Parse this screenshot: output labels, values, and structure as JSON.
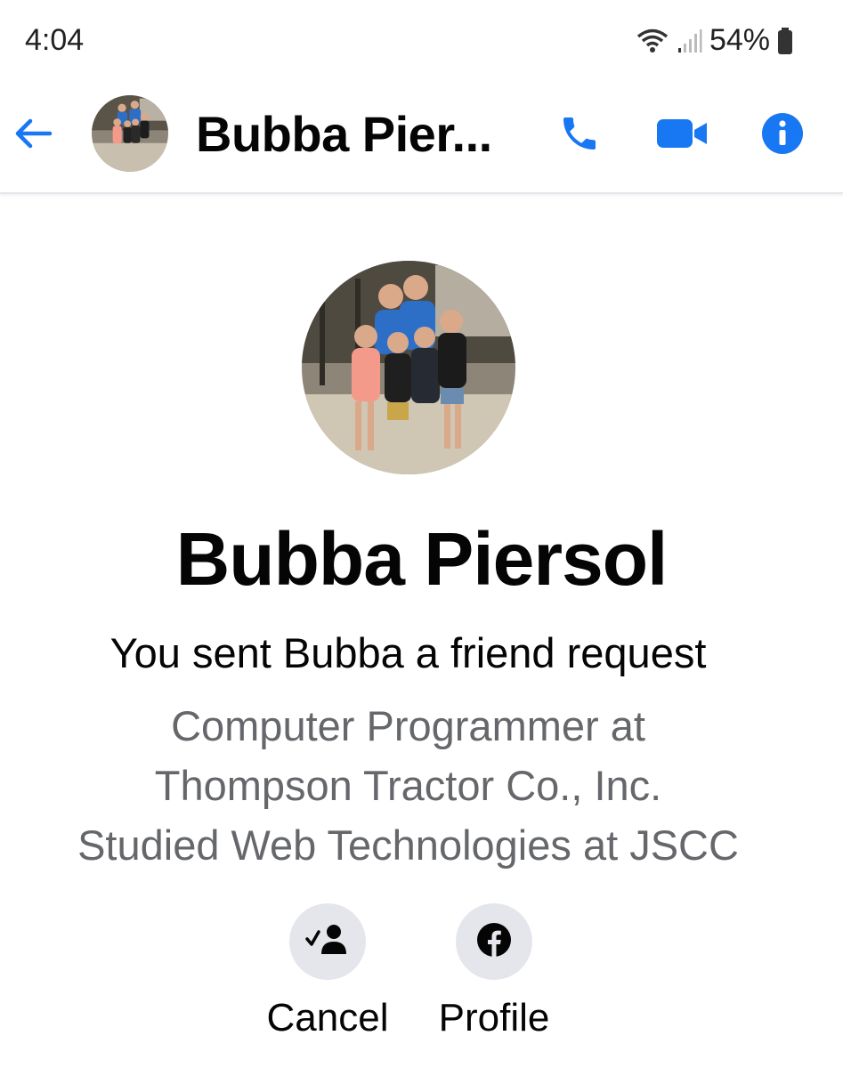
{
  "status_bar": {
    "time": "4:04",
    "battery": "54%"
  },
  "header": {
    "title": "Bubba Pier...",
    "back_icon": "back-arrow-icon",
    "actions": [
      "phone-icon",
      "video-camera-icon",
      "info-icon"
    ],
    "accent_color": "#1877f2"
  },
  "profile": {
    "name": "Bubba Piersol",
    "friend_status": "You sent Bubba a friend request",
    "job_line1": "Computer Programmer at",
    "job_line2": "Thompson Tractor Co., Inc.",
    "school": "Studied Web Technologies at JSCC"
  },
  "actions": {
    "cancel_label": "Cancel",
    "profile_label": "Profile"
  }
}
